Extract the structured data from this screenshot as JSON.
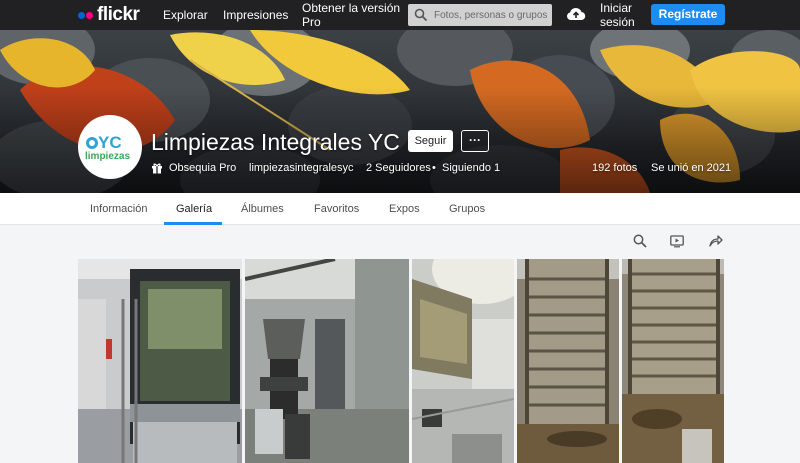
{
  "nav": {
    "logo_text": "flickr",
    "explore": "Explorar",
    "prints": "Impresiones",
    "pro": "Obtener la versión Pro",
    "search_placeholder": "Fotos, personas o grupos",
    "login": "Iniciar sesión",
    "signup": "Regístrate"
  },
  "profile": {
    "name": "Limpiezas Integrales YC",
    "follow": "Seguir",
    "more": "···",
    "gift_pro": "Obsequia Pro",
    "username": "limpiezasintegralesyc",
    "followers": "2 Seguidores",
    "bullet": "•",
    "following": "Siguiendo 1",
    "photos": "192 fotos",
    "joined": "Se unió en 2021",
    "avatar_text_top": "YC",
    "avatar_text_bottom": "limpiezas"
  },
  "tabs": [
    {
      "label": "Información"
    },
    {
      "label": "Galería"
    },
    {
      "label": "Álbumes"
    },
    {
      "label": "Favoritos"
    },
    {
      "label": "Expos"
    },
    {
      "label": "Grupos"
    }
  ],
  "active_tab": "Galería",
  "toolbar": {
    "icons": [
      "search-icon",
      "slideshow-icon",
      "share-icon"
    ]
  },
  "photos": [
    {
      "subject": "oven"
    },
    {
      "subject": "coffee-grinder"
    },
    {
      "subject": "extractor-hood"
    },
    {
      "subject": "oven-rack"
    },
    {
      "subject": "oven-rack-2"
    }
  ],
  "colors": {
    "nav_bg": "#212124",
    "accent": "#1c8cf3",
    "flickr_blue": "#0063dc",
    "flickr_pink": "#ff0084"
  }
}
